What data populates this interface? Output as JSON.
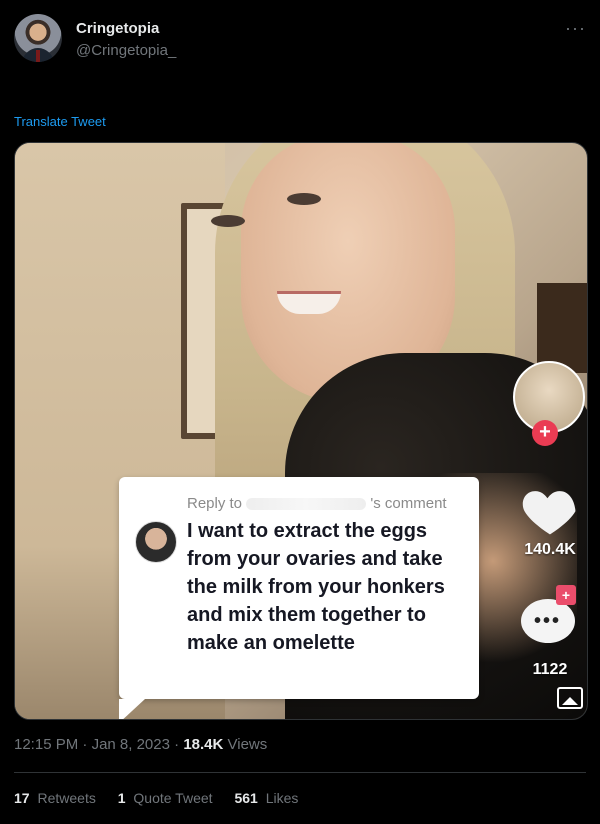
{
  "tweet": {
    "author_name": "Cringetopia",
    "author_handle": "@Cringetopia_",
    "more_icon": "more-horizontal-icon",
    "translate_label": "Translate Tweet",
    "time": "12:15 PM",
    "date": "Jan 8, 2023",
    "views_count": "18.4K",
    "views_label": "Views",
    "retweets_count": "17",
    "retweets_label": "Retweets",
    "quotes_count": "1",
    "quotes_label": "Quote Tweet",
    "likes_count": "561",
    "likes_label": "Likes"
  },
  "media": {
    "reply_label_prefix": "Reply to",
    "reply_label_suffix": "'s comment",
    "reply_text": "I want to extract the eggs from your ovaries and take the milk from your honkers and mix them together to make an omelette",
    "likes_count": "140.4K",
    "comments_count": "1122"
  },
  "colors": {
    "background": "#000000",
    "link_blue": "#1d9bf0",
    "tiktok_red": "#ea3c53"
  }
}
